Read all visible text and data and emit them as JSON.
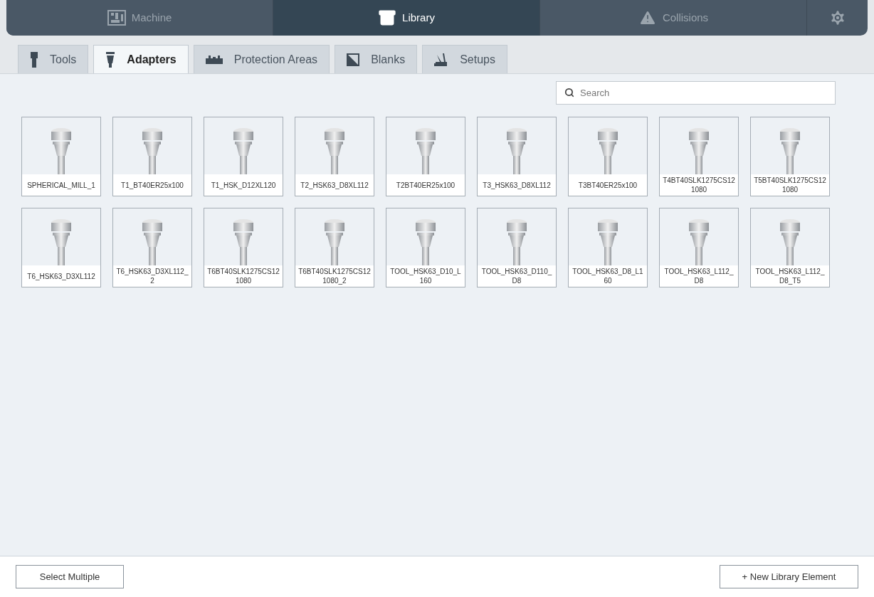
{
  "nav": [
    {
      "label": "Machine",
      "selected": false
    },
    {
      "label": "Library",
      "selected": true
    },
    {
      "label": "Collisions",
      "selected": false
    }
  ],
  "tabs": [
    {
      "label": "Tools",
      "selected": false
    },
    {
      "label": "Adapters",
      "selected": true
    },
    {
      "label": "Protection Areas",
      "selected": false
    },
    {
      "label": "Blanks",
      "selected": false
    },
    {
      "label": "Setups",
      "selected": false
    }
  ],
  "search": {
    "placeholder": "Search"
  },
  "items": [
    {
      "label": "SPHERICAL_MILL_1"
    },
    {
      "label": "T1_BT40ER25x100"
    },
    {
      "label": "T1_HSK_D12XL120"
    },
    {
      "label": "T2_HSK63_D8XL112"
    },
    {
      "label": "T2BT40ER25x100"
    },
    {
      "label": "T3_HSK63_D8XL112"
    },
    {
      "label": "T3BT40ER25x100"
    },
    {
      "label": "T4BT40SLK1275CS121080"
    },
    {
      "label": "T5BT40SLK1275CS121080"
    },
    {
      "label": "T6_HSK63_D3XL112"
    },
    {
      "label": "T6_HSK63_D3XL112_2"
    },
    {
      "label": "T6BT40SLK1275CS121080"
    },
    {
      "label": "T6BT40SLK1275CS121080_2"
    },
    {
      "label": "TOOL_HSK63_D10_L160"
    },
    {
      "label": "TOOL_HSK63_D110_D8"
    },
    {
      "label": "TOOL_HSK63_D8_L160"
    },
    {
      "label": "TOOL_HSK63_L112_D8"
    },
    {
      "label": "TOOL_HSK63_L112_D8_T5"
    }
  ],
  "footer": {
    "left_button": "Select Multiple",
    "right_button": "+ New Library Element"
  }
}
